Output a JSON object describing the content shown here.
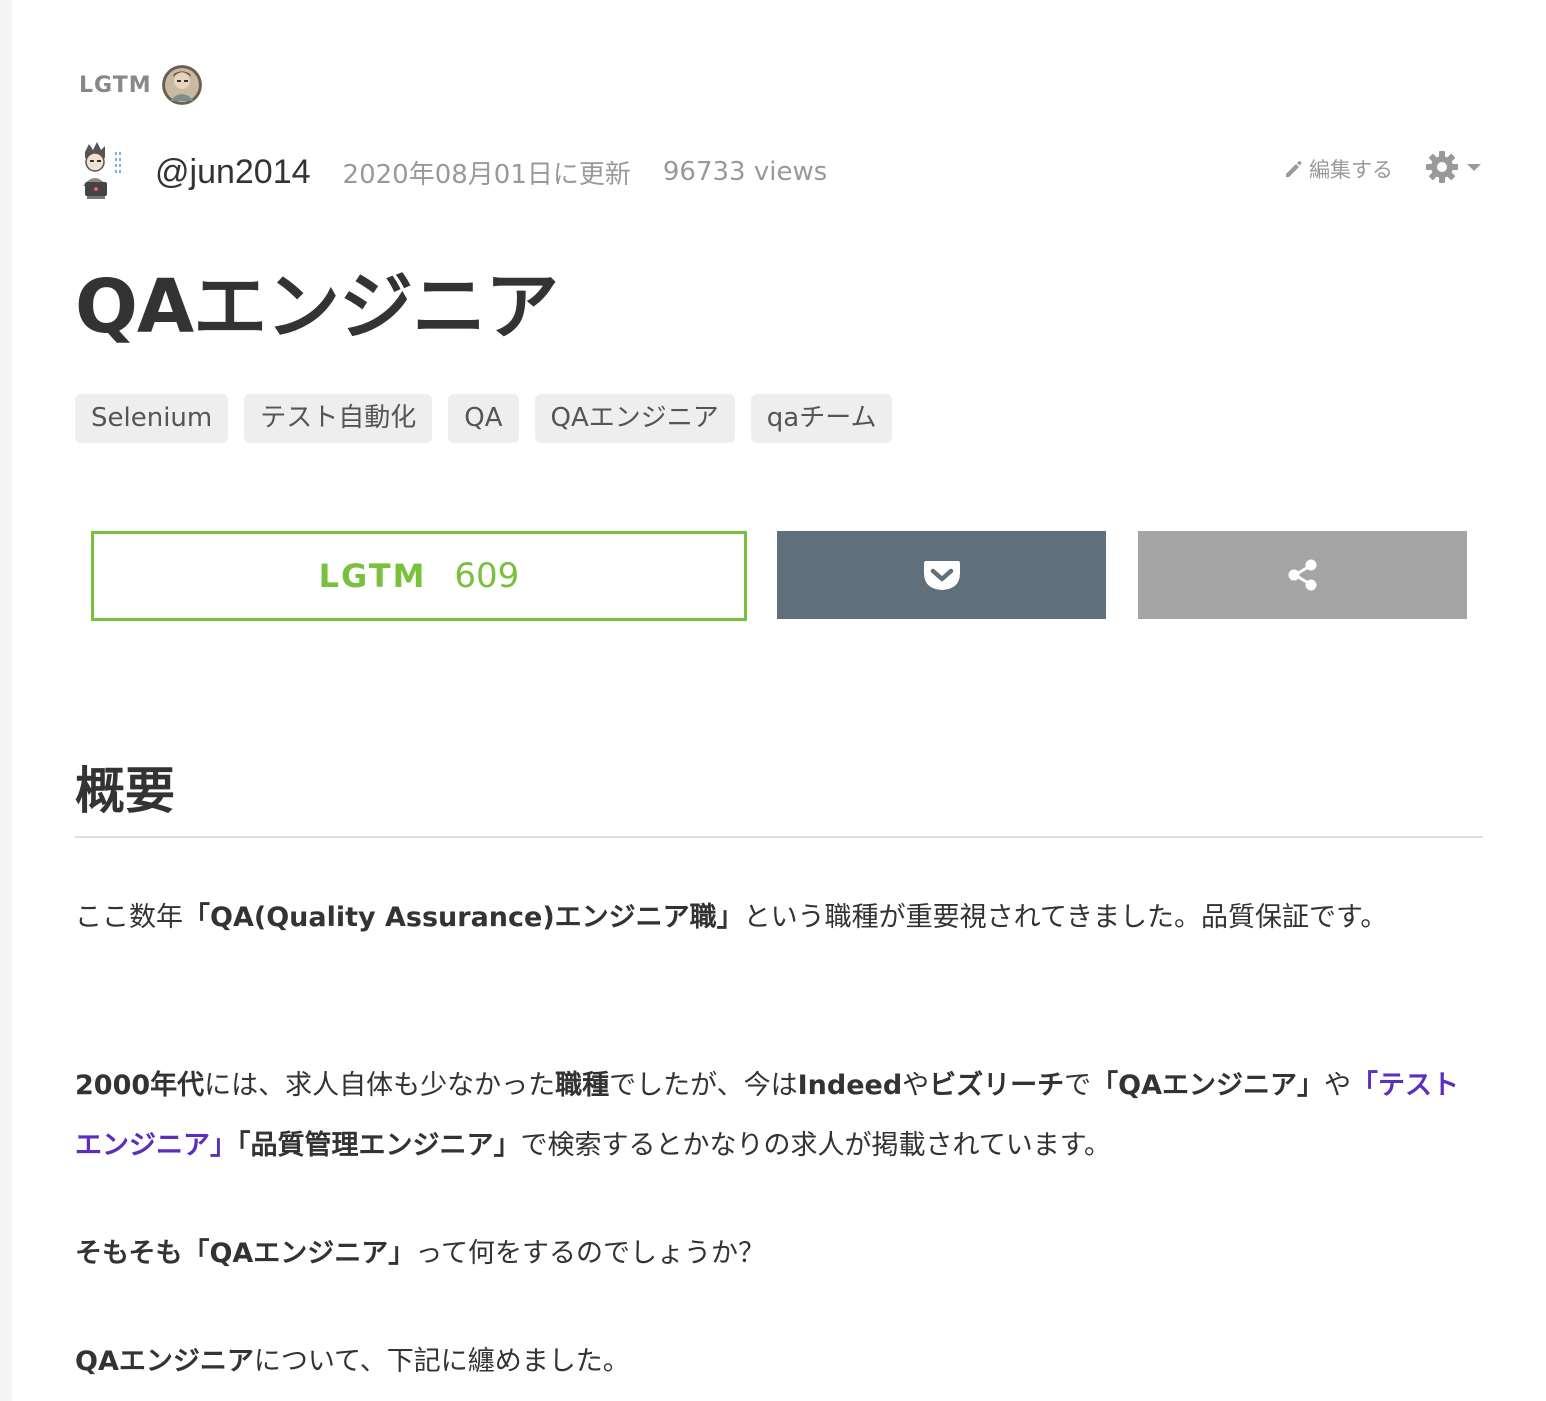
{
  "lgtm_strip": {
    "label": "LGTM"
  },
  "author": {
    "name": "@jun2014",
    "updated": "2020年08月01日に更新",
    "views": "96733 views"
  },
  "toolbar": {
    "edit_label": "編集する",
    "edit_icon": "pencil-icon",
    "settings_icon": "gear-icon"
  },
  "article": {
    "title": "QAエンジニア",
    "tags": [
      "Selenium",
      "テスト自動化",
      "QA",
      "QAエンジニア",
      "qaチーム"
    ]
  },
  "actions": {
    "lgtm_label": "LGTM",
    "lgtm_count": "609",
    "pocket_icon": "pocket-icon",
    "share_icon": "share-icon"
  },
  "colors": {
    "lgtm_green": "#79c13d",
    "pocket_bg": "#5f707c",
    "share_bg": "#a5a5a5",
    "link_purple": "#5b2ec0"
  },
  "body": {
    "heading": "概要",
    "p1": {
      "t1": "ここ数年",
      "b1": "「QA(Quality Assurance)エンジニア職」",
      "t2": "という職種が重要視されてきました。品質保証です。"
    },
    "p2": {
      "b1": "2000年代",
      "t1": "には、求人自体も少なかった",
      "b2": "職種",
      "t2": "でしたが、今は",
      "b3": "Indeed",
      "t3": "や",
      "b4": "ビズリーチ",
      "t4": "で",
      "b5": "「QAエンジニア」",
      "t5": "や",
      "link": "「テストエンジニア」",
      "b6": "「品質管理エンジニア」",
      "t6": "で検索するとかなりの求人が掲載されています。"
    },
    "p3": {
      "b1": "そもそも「QAエンジニア」",
      "t1": "って何をするのでしょうか？"
    },
    "p4": {
      "b1": "QAエンジニア",
      "t1": "について、下記に纏めました。"
    }
  }
}
